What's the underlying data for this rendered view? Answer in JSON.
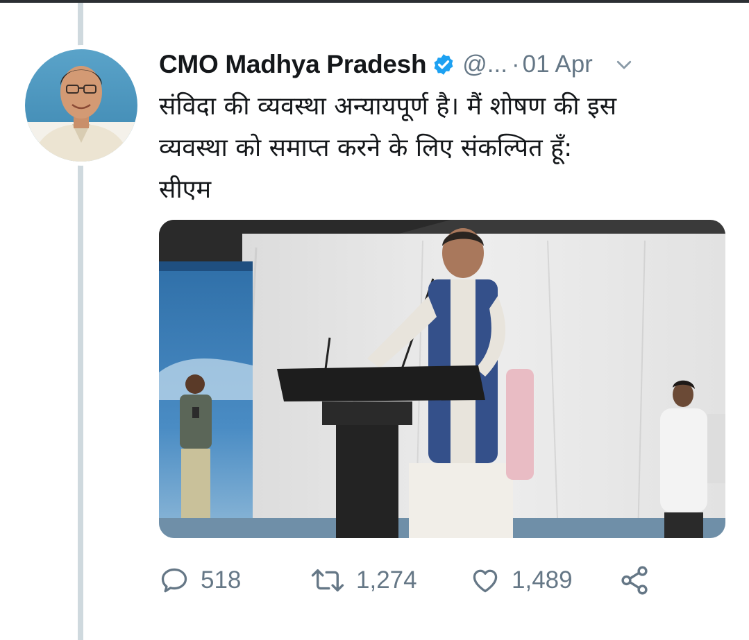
{
  "tweet": {
    "display_name": "CMO Madhya Pradesh",
    "handle": "@...",
    "separator": "·",
    "date": "01 Apr",
    "text_lines": [
      "संविदा की व्यवस्था अन्यायपूर्ण है। मैं शोषण की इस",
      "व्यवस्था को समाप्त करने के लिए संकल्पित हूँ:",
      "सीएम"
    ]
  },
  "actions": {
    "reply_count": "518",
    "retweet_count": "1,274",
    "like_count": "1,489"
  },
  "icons": {
    "verified": "verified-badge-icon",
    "caret": "chevron-down-icon",
    "reply": "reply-icon",
    "retweet": "retweet-icon",
    "like": "heart-icon",
    "share": "share-icon"
  },
  "colors": {
    "text_primary": "#14171a",
    "text_secondary": "#657786",
    "verified_blue": "#1da1f2",
    "thread_line": "#cfd9de"
  }
}
